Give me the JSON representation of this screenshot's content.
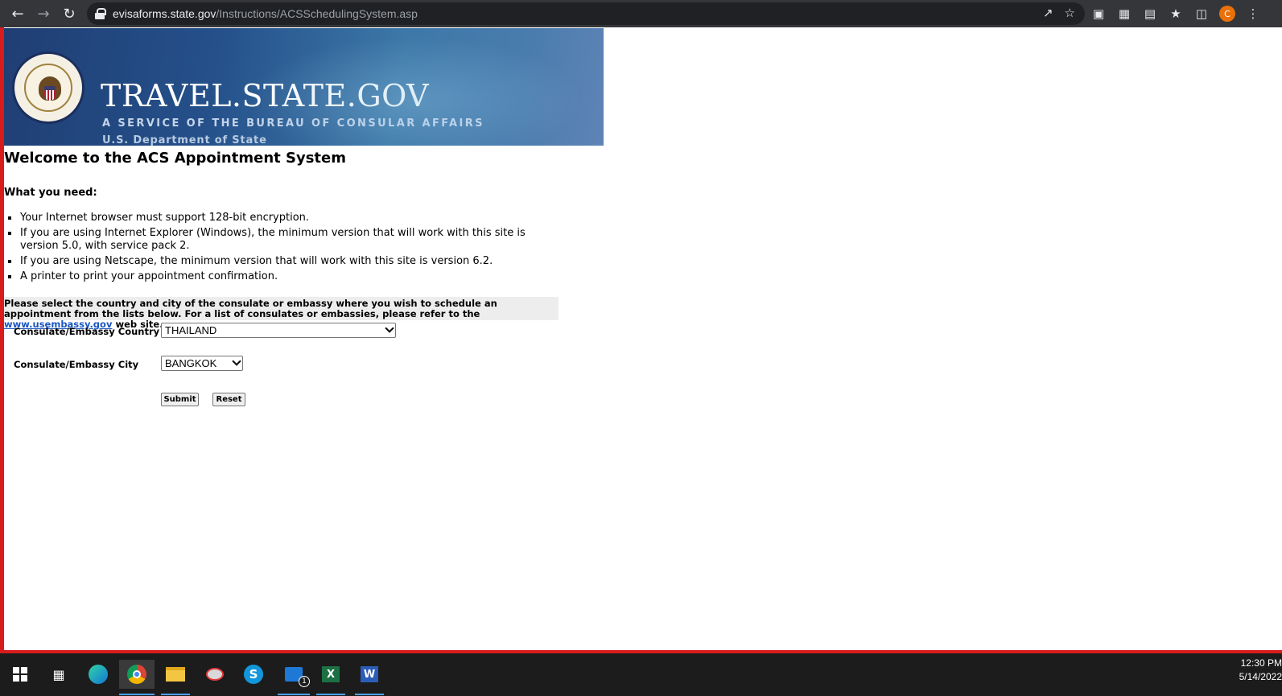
{
  "browser": {
    "url_host": "evisaforms.state.gov",
    "url_path": "/Instructions/ACSSchedulingSystem.asp",
    "profile_initial": "C"
  },
  "banner": {
    "title": "TRAVEL.STATE.GOV",
    "subtitle": "A SERVICE OF THE BUREAU OF CONSULAR AFFAIRS",
    "department": "U.S. Department of State"
  },
  "page": {
    "title": "Welcome to the ACS Appointment System",
    "need_title": "What you need:",
    "needs": [
      "Your Internet browser must support 128-bit encryption.",
      "If you are using Internet Explorer (Windows), the minimum version that will work with this site is version 5.0, with service pack 2.",
      "If you are using Netscape, the minimum version that will work with this site is version 6.2.",
      "A printer to print your appointment confirmation."
    ],
    "instruction_text": "Please select the country and city of the consulate or embassy where you wish to schedule an appointment from the lists below. For a list of consulates or embassies, please refer to the",
    "instruction_link": "www.usembassy.gov",
    "instruction_tail": "web site."
  },
  "form": {
    "country_label": "Consulate/Embassy Country",
    "country_value": "THAILAND",
    "city_label": "Consulate/Embassy City",
    "city_value": "BANGKOK",
    "submit_label": "Submit",
    "reset_label": "Reset"
  },
  "taskbar": {
    "time": "12:30 PM",
    "date": "5/14/2022",
    "mail_badge": "1"
  }
}
